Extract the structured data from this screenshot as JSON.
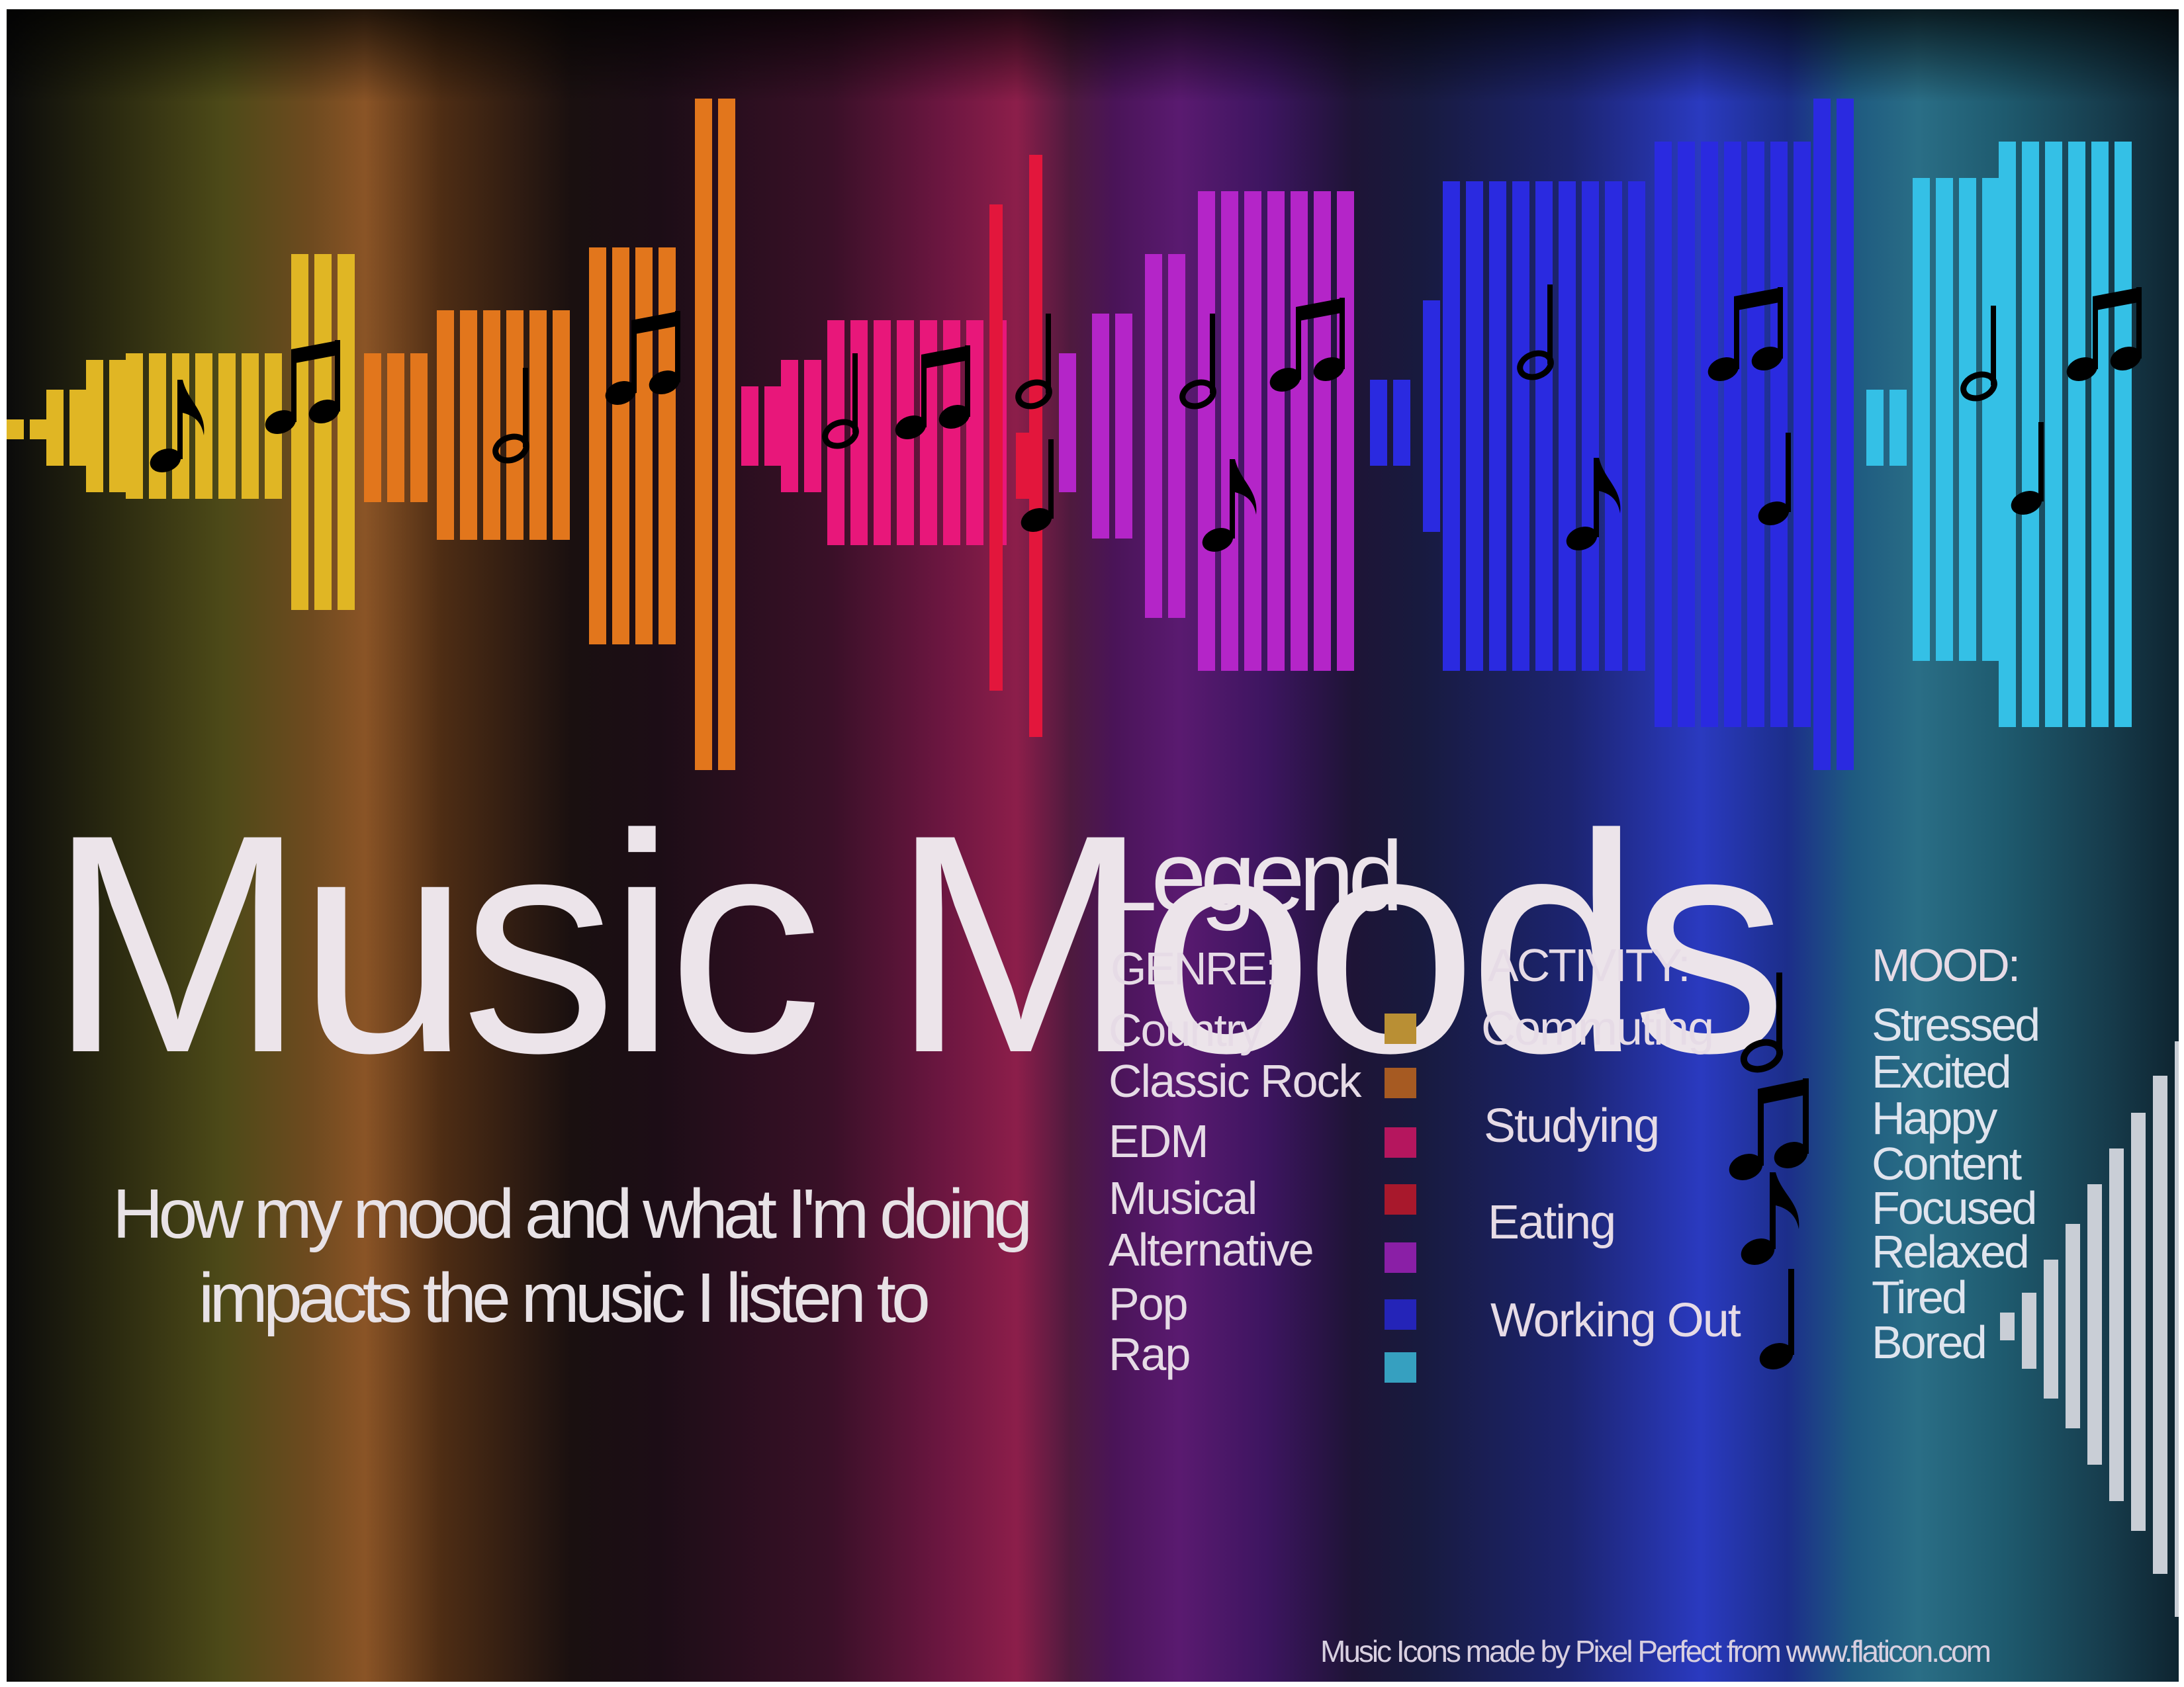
{
  "title": "Music Moods",
  "subtitle": {
    "line1": "How my mood and what I'm doing",
    "line2": "impacts the music I listen to"
  },
  "legend": {
    "title": "Legend",
    "genre_heading": "GENRE:",
    "activity_heading": "ACTIVITY:",
    "mood_heading": "MOOD:",
    "genres": [
      {
        "label": "Country",
        "color": "#b98f34"
      },
      {
        "label": "Classic Rock",
        "color": "#a65a22"
      },
      {
        "label": "EDM",
        "color": "#b5165e"
      },
      {
        "label": "Musical",
        "color": "#a8182c"
      },
      {
        "label": "Alternative",
        "color": "#8a1fa6"
      },
      {
        "label": "Pop",
        "color": "#2424b8"
      },
      {
        "label": "Rap",
        "color": "#36a0c0"
      }
    ],
    "activities": [
      {
        "label": "Commuting",
        "icon": "half-note-icon"
      },
      {
        "label": "Studying",
        "icon": "beamed-eighth-notes-icon"
      },
      {
        "label": "Eating",
        "icon": "eighth-note-icon"
      },
      {
        "label": "Working Out",
        "icon": "quarter-note-icon"
      }
    ],
    "moods": [
      "Stressed",
      "Excited",
      "Happy",
      "Content",
      "Focused",
      "Relaxed",
      "Tired",
      "Bored"
    ]
  },
  "credit": "Music Icons made by Pixel Perfect from www.flaticon.com",
  "colors": {
    "Country": "#e0b624",
    "Classic Rock": "#e2761c",
    "EDM": "#e8177a",
    "Musical": "#e3163c",
    "Alternative": "#b425c8",
    "Pop": "#2a2ae0",
    "Rap": "#34c0e6",
    "mood_scale": "#c9ced6"
  }
}
